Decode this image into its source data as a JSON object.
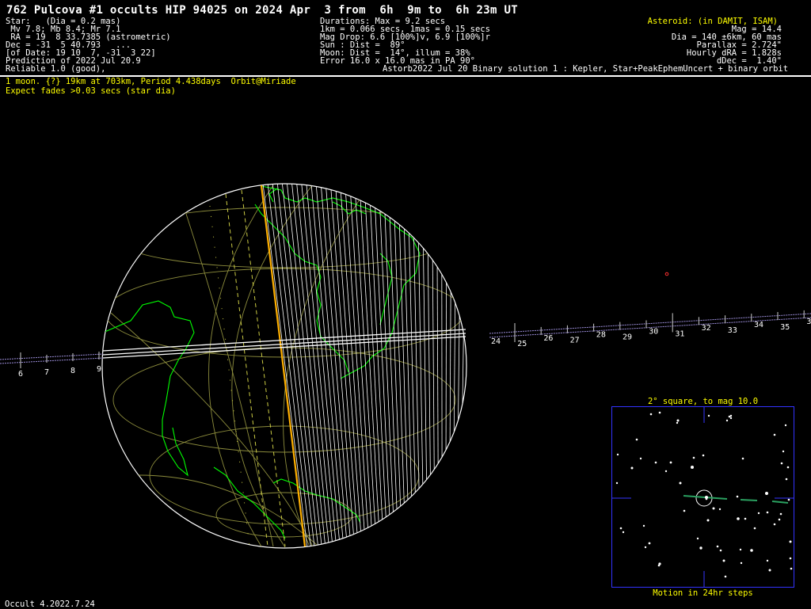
{
  "header": {
    "title": "762 Pulcova #1 occults HIP 94025 on 2024 Apr  3 from  6h  9m to  6h 23m UT",
    "star_lines": [
      "Star:   (Dia = 0.2 mas)",
      " Mv 7.8; Mb 8.4; Mr 7.1",
      " RA = 19  8 33.7385 (astrometric)",
      "Dec = -31  5 40.793   ...",
      "[of Date: 19 10  7, -31  3 22]",
      "Prediction of 2022 Jul 20.9",
      "Reliable 1.0 (good),"
    ],
    "event_lines": [
      "Durations: Max = 9.2 secs",
      "1km = 0.066 secs, 1mas = 0.15 secs",
      "Mag Drop: 6.6 [100%]v, 6.9 [100%]r",
      "Sun : Dist =  89°",
      "Moon: Dist =  14°, illum = 38%",
      "Error 16.0 x 16.0 mas in PA 90°"
    ],
    "asteroid_lines": [
      "Asteroid: (in DAMIT, ISAM)",
      "Mag = 14.4",
      "Dia = 140 ±6km, 60 mas",
      "Parallax = 2.724\"",
      "Hourly dRA = 1.828s",
      "dDec =  1.40\""
    ],
    "orbit_line": "Astorb2022 Jul 20 Binary solution 1 : Kepler, Star+PeakEphemUncert + binary orbit",
    "moon_line": "1 moon. {?} 19km at 703km, Period 4.438days  Orbit@Miriade",
    "fade_line": "Expect fades >0.03 secs (star dia)"
  },
  "track": {
    "left_ticks": [
      "6",
      "7",
      "8",
      "9"
    ],
    "right_ticks": [
      "24",
      "25",
      "26",
      "27",
      "28",
      "29",
      "30",
      "31",
      "32",
      "33",
      "34",
      "35",
      "3"
    ]
  },
  "finder": {
    "title": "2° square, to mag 10.0",
    "footer": "Motion in 24hr steps"
  },
  "footer": {
    "version": "Occult 4.2022.7.24"
  },
  "colors": {
    "background": "#000000",
    "text": "#ffffff",
    "highlight": "#ffff00",
    "coastline": "#00ff00",
    "path_line": "#ffb000",
    "graticule": "#8c8c3c",
    "finder_border": "#3333ff"
  }
}
